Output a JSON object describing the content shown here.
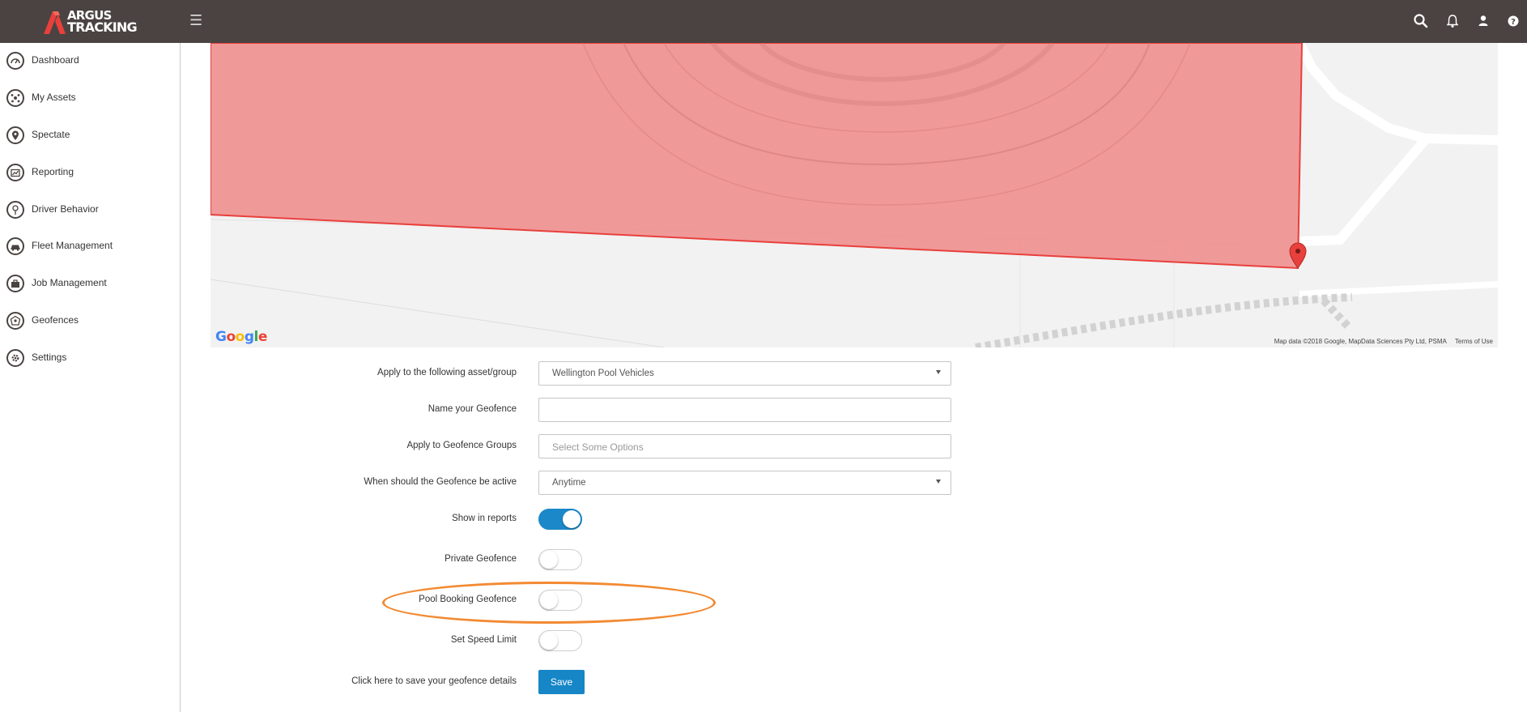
{
  "brand": {
    "line1": "ARGUS",
    "line2": "TRACKING",
    "colors": {
      "topbar": "#4a4341",
      "accent": "#1686c7",
      "logo_mark": "#e8403c",
      "highlight": "#f28a32"
    }
  },
  "topbar": {
    "menu_icon": "☰",
    "icons": [
      "search-icon",
      "bell-icon",
      "user-icon",
      "help-icon"
    ]
  },
  "sidebar": {
    "items": [
      {
        "label": "Dashboard",
        "icon": "speedometer-icon"
      },
      {
        "label": "My Assets",
        "icon": "assets-icon"
      },
      {
        "label": "Spectate",
        "icon": "map-pin-icon"
      },
      {
        "label": "Reporting",
        "icon": "chart-icon"
      },
      {
        "label": "Driver Behavior",
        "icon": "driver-icon"
      },
      {
        "label": "Fleet Management",
        "icon": "car-icon"
      },
      {
        "label": "Job Management",
        "icon": "briefcase-icon"
      },
      {
        "label": "Geofences",
        "icon": "geofence-icon"
      },
      {
        "label": "Settings",
        "icon": "gear-icon"
      }
    ]
  },
  "map": {
    "provider": "Google",
    "attribution": "Map data ©2018 Google, MapData Sciences Pty Ltd, PSMA",
    "terms": "Terms of Use",
    "geofence_fill": "#f08a8a",
    "geofence_stroke": "#e8403c"
  },
  "form": {
    "asset_group": {
      "label": "Apply to the following asset/group",
      "value": "Wellington Pool Vehicles"
    },
    "name": {
      "label": "Name your Geofence",
      "value": ""
    },
    "groups": {
      "label": "Apply to Geofence Groups",
      "placeholder": "Select Some Options"
    },
    "active": {
      "label": "When should the Geofence be active",
      "value": "Anytime"
    },
    "show_in_reports": {
      "label": "Show in reports",
      "on": true
    },
    "private": {
      "label": "Private Geofence",
      "on": false
    },
    "pool_booking": {
      "label": "Pool Booking Geofence",
      "on": false
    },
    "speed_limit": {
      "label": "Set Speed Limit",
      "on": false
    },
    "save": {
      "label": "Click here to save your geofence details",
      "button": "Save"
    }
  }
}
